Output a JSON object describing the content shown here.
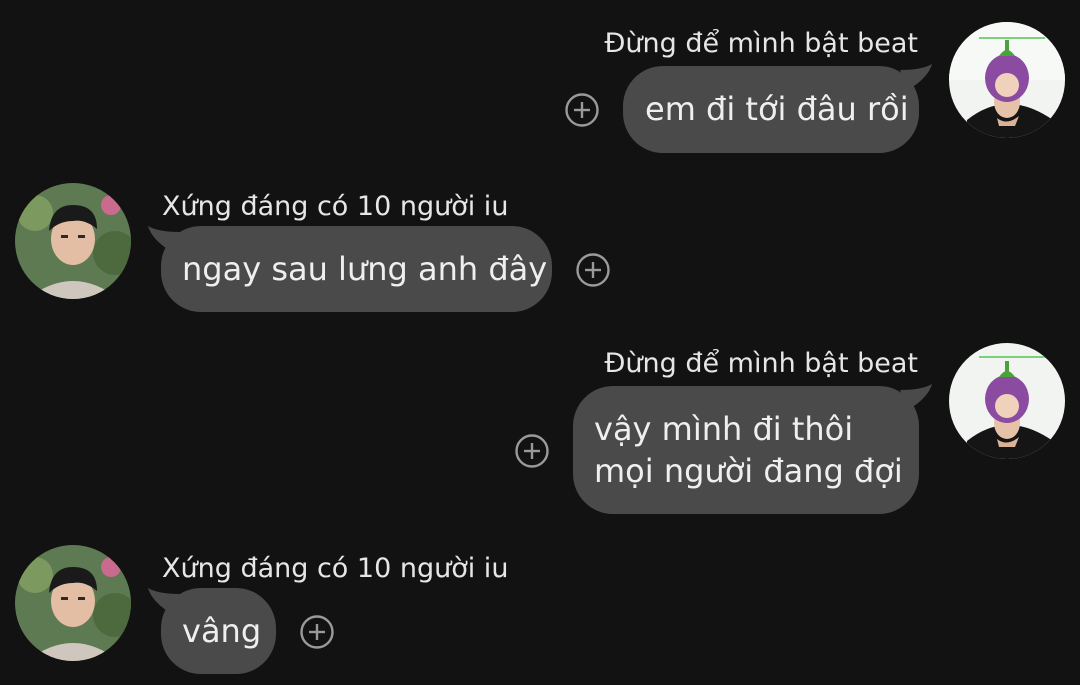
{
  "messages": [
    {
      "side": "right",
      "sender": "Đừng để mình bật beat",
      "lines": [
        "em đi tới đâu rồi"
      ]
    },
    {
      "side": "left",
      "sender": "Xứng đáng có 10 người iu",
      "lines": [
        "ngay sau lưng anh đây"
      ]
    },
    {
      "side": "right",
      "sender": "Đừng để mình bật beat",
      "lines": [
        "vậy mình đi thôi",
        "mọi người đang đợi"
      ]
    },
    {
      "side": "left",
      "sender": "Xứng đáng có 10 người iu",
      "lines": [
        "vâng"
      ]
    }
  ],
  "icons": {
    "react": "add-reaction-icon",
    "avatar_right": "eggplant-hat-avatar",
    "avatar_left": "boy-portrait-avatar"
  },
  "colors": {
    "background": "#121212",
    "bubble": "#4a4a4a",
    "text": "#efefef"
  }
}
